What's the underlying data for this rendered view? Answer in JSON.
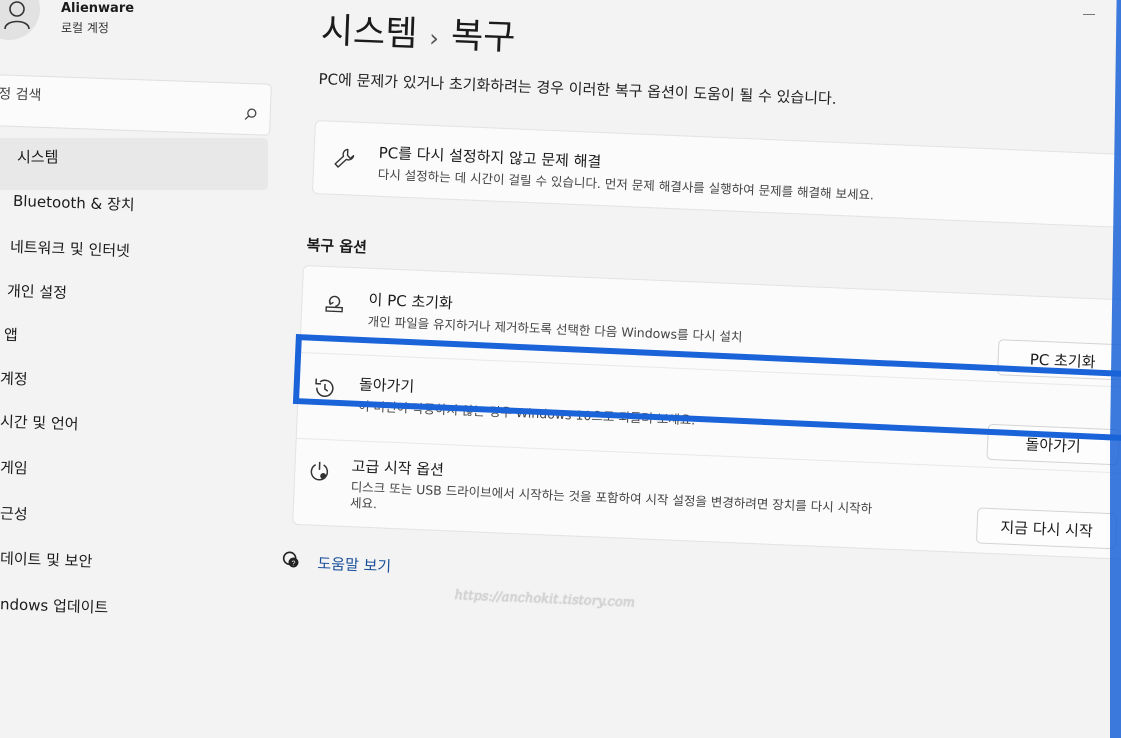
{
  "account": {
    "name": "Alienware",
    "type": "로컬 계정",
    "icon": "person-icon"
  },
  "search": {
    "placeholder": "정 검색",
    "icon": "search-icon"
  },
  "sidebar": {
    "items": [
      {
        "label": "시스템",
        "active": true
      },
      {
        "label": "Bluetooth & 장치"
      },
      {
        "label": "네트워크 및 인터넷"
      },
      {
        "label": "개인 설정"
      },
      {
        "label": "앱"
      },
      {
        "label": "계정"
      },
      {
        "label": "시간 및 언어"
      },
      {
        "label": "게임"
      },
      {
        "label": "근성"
      },
      {
        "label": "데이트 및 보안"
      },
      {
        "label": "ndows 업데이트"
      }
    ]
  },
  "header": {
    "parent": "시스템",
    "separator": "›",
    "current": "복구"
  },
  "subtitle": "PC에 문제가 있거나 초기화하려는 경우 이러한 복구 옵션이 도움이 될 수 있습니다.",
  "troubleshoot": {
    "title": "PC를 다시 설정하지 않고 문제 해결",
    "description": "다시 설정하는 데 시간이 걸릴 수 있습니다. 먼저 문제 해결사를 실행하여 문제를 해결해 보세요.",
    "icon": "wrench-icon"
  },
  "recovery": {
    "section_title": "복구 옵션",
    "options": [
      {
        "title": "이 PC 초기화",
        "description": "개인 파일을 유지하거나 제거하도록 선택한 다음 Windows를 다시 설치",
        "button": "PC 초기화",
        "icon": "reset-pc-icon"
      },
      {
        "title": "돌아가기",
        "description": "이 버전이 작동하지 않는 경우 Windows 10으로 되돌려 보세요.",
        "button": "돌아가기",
        "icon": "history-icon"
      },
      {
        "title": "고급 시작 옵션",
        "description": "디스크 또는 USB 드라이브에서 시작하는 것을 포함하여 시작 설정을 변경하려면 장치를 다시 시작하",
        "description_line2": "세요.",
        "button": "지금 다시 시작",
        "icon": "advanced-startup-icon"
      }
    ]
  },
  "help": {
    "label": "도움말 보기",
    "icon": "help-icon"
  },
  "watermark": "https://anchokit.tistory.com",
  "colors": {
    "highlight": "#1a63d8",
    "link": "#1a4f9a"
  }
}
